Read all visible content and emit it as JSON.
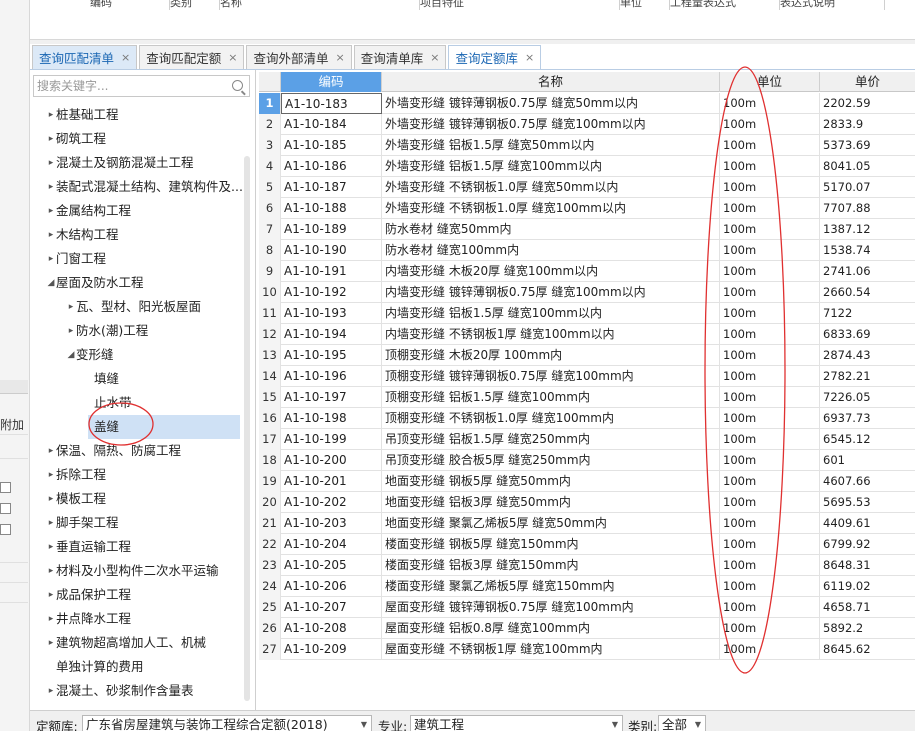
{
  "top_header_fragments": [
    "编码",
    "类别",
    "名称",
    "项目特征",
    "单位",
    "工程量表达式",
    "表达式说明"
  ],
  "left_strip": {
    "label": "附加"
  },
  "tabs": [
    {
      "label": "查询匹配清单",
      "state": "active"
    },
    {
      "label": "查询匹配定额",
      "state": "normal"
    },
    {
      "label": "查询外部清单",
      "state": "normal"
    },
    {
      "label": "查询清单库",
      "state": "normal"
    },
    {
      "label": "查询定额库",
      "state": "current"
    }
  ],
  "search": {
    "placeholder": "搜索关键字..."
  },
  "tree": [
    {
      "label": "桩基础工程",
      "level": 0,
      "arrow": "right"
    },
    {
      "label": "砌筑工程",
      "level": 0,
      "arrow": "right"
    },
    {
      "label": "混凝土及钢筋混凝土工程",
      "level": 0,
      "arrow": "right"
    },
    {
      "label": "装配式混凝土结构、建筑构件及...",
      "level": 0,
      "arrow": "right"
    },
    {
      "label": "金属结构工程",
      "level": 0,
      "arrow": "right"
    },
    {
      "label": "木结构工程",
      "level": 0,
      "arrow": "right"
    },
    {
      "label": "门窗工程",
      "level": 0,
      "arrow": "right"
    },
    {
      "label": "屋面及防水工程",
      "level": 0,
      "arrow": "down"
    },
    {
      "label": "瓦、型材、阳光板屋面",
      "level": 1,
      "arrow": "right"
    },
    {
      "label": "防水(潮)工程",
      "level": 1,
      "arrow": "right"
    },
    {
      "label": "变形缝",
      "level": 1,
      "arrow": "down"
    },
    {
      "label": "填缝",
      "level": 2,
      "arrow": ""
    },
    {
      "label": "止水带",
      "level": 2,
      "arrow": ""
    },
    {
      "label": "盖缝",
      "level": 2,
      "arrow": "",
      "selected": true
    },
    {
      "label": "保温、隔热、防腐工程",
      "level": 0,
      "arrow": "right"
    },
    {
      "label": "拆除工程",
      "level": 0,
      "arrow": "right"
    },
    {
      "label": "模板工程",
      "level": 0,
      "arrow": "right"
    },
    {
      "label": "脚手架工程",
      "level": 0,
      "arrow": "right"
    },
    {
      "label": "垂直运输工程",
      "level": 0,
      "arrow": "right"
    },
    {
      "label": "材料及小型构件二次水平运输",
      "level": 0,
      "arrow": "right"
    },
    {
      "label": "成品保护工程",
      "level": 0,
      "arrow": "right"
    },
    {
      "label": "井点降水工程",
      "level": 0,
      "arrow": "right"
    },
    {
      "label": "建筑物超高增加人工、机械",
      "level": 0,
      "arrow": "right"
    },
    {
      "label": "单独计算的费用",
      "level": 0,
      "arrow": "",
      "indent_override": true
    },
    {
      "label": "混凝土、砂浆制作含量表",
      "level": 0,
      "arrow": "right"
    }
  ],
  "grid": {
    "columns": [
      "编码",
      "名称",
      "单位",
      "单价"
    ],
    "rows": [
      [
        "A1-10-183",
        "外墙变形缝 镀锌薄钢板0.75厚 缝宽50mm以内",
        "100m",
        "2202.59"
      ],
      [
        "A1-10-184",
        "外墙变形缝 镀锌薄钢板0.75厚 缝宽100mm以内",
        "100m",
        "2833.9"
      ],
      [
        "A1-10-185",
        "外墙变形缝 铝板1.5厚 缝宽50mm以内",
        "100m",
        "5373.69"
      ],
      [
        "A1-10-186",
        "外墙变形缝 铝板1.5厚 缝宽100mm以内",
        "100m",
        "8041.05"
      ],
      [
        "A1-10-187",
        "外墙变形缝 不锈钢板1.0厚 缝宽50mm以内",
        "100m",
        "5170.07"
      ],
      [
        "A1-10-188",
        "外墙变形缝 不锈钢板1.0厚 缝宽100mm以内",
        "100m",
        "7707.88"
      ],
      [
        "A1-10-189",
        "防水卷材 缝宽50mm内",
        "100m",
        "1387.12"
      ],
      [
        "A1-10-190",
        "防水卷材 缝宽100mm内",
        "100m",
        "1538.74"
      ],
      [
        "A1-10-191",
        "内墙变形缝 木板20厚 缝宽100mm以内",
        "100m",
        "2741.06"
      ],
      [
        "A1-10-192",
        "内墙变形缝 镀锌薄钢板0.75厚 缝宽100mm以内",
        "100m",
        "2660.54"
      ],
      [
        "A1-10-193",
        "内墙变形缝 铝板1.5厚 缝宽100mm以内",
        "100m",
        "7122"
      ],
      [
        "A1-10-194",
        "内墙变形缝 不锈钢板1厚 缝宽100mm以内",
        "100m",
        "6833.69"
      ],
      [
        "A1-10-195",
        "顶棚变形缝 木板20厚 100mm内",
        "100m",
        "2874.43"
      ],
      [
        "A1-10-196",
        "顶棚变形缝 镀锌薄钢板0.75厚 缝宽100mm内",
        "100m",
        "2782.21"
      ],
      [
        "A1-10-197",
        "顶棚变形缝 铝板1.5厚 缝宽100mm内",
        "100m",
        "7226.05"
      ],
      [
        "A1-10-198",
        "顶棚变形缝 不锈钢板1.0厚 缝宽100mm内",
        "100m",
        "6937.73"
      ],
      [
        "A1-10-199",
        "吊顶变形缝 铝板1.5厚 缝宽250mm内",
        "100m",
        "6545.12"
      ],
      [
        "A1-10-200",
        "吊顶变形缝 胶合板5厚 缝宽250mm内",
        "100m",
        "601"
      ],
      [
        "A1-10-201",
        "地面变形缝 钢板5厚 缝宽50mm内",
        "100m",
        "4607.66"
      ],
      [
        "A1-10-202",
        "地面变形缝 铝板3厚 缝宽50mm内",
        "100m",
        "5695.53"
      ],
      [
        "A1-10-203",
        "地面变形缝 聚氯乙烯板5厚 缝宽50mm内",
        "100m",
        "4409.61"
      ],
      [
        "A1-10-204",
        "楼面变形缝 钢板5厚 缝宽150mm内",
        "100m",
        "6799.92"
      ],
      [
        "A1-10-205",
        "楼面变形缝 铝板3厚 缝宽150mm内",
        "100m",
        "8648.31"
      ],
      [
        "A1-10-206",
        "楼面变形缝 聚氯乙烯板5厚 缝宽150mm内",
        "100m",
        "6119.02"
      ],
      [
        "A1-10-207",
        "屋面变形缝 镀锌薄钢板0.75厚 缝宽100mm内",
        "100m",
        "4658.71"
      ],
      [
        "A1-10-208",
        "屋面变形缝 铝板0.8厚 缝宽100mm内",
        "100m",
        "5892.2"
      ],
      [
        "A1-10-209",
        "屋面变形缝 不锈钢板1厚 缝宽100mm内",
        "100m",
        "8645.62"
      ]
    ]
  },
  "bottom_bar": {
    "quota_label": "定额库:",
    "quota_value": "广东省房屋建筑与装饰工程综合定额(2018)",
    "major_label": "专业:",
    "major_value": "建筑工程",
    "category_label": "类别:",
    "category_value": "全部"
  },
  "colors": {
    "accent": "#5ba0e6",
    "tab_active_text": "#1a66b3",
    "annotation_red": "#e03030"
  }
}
